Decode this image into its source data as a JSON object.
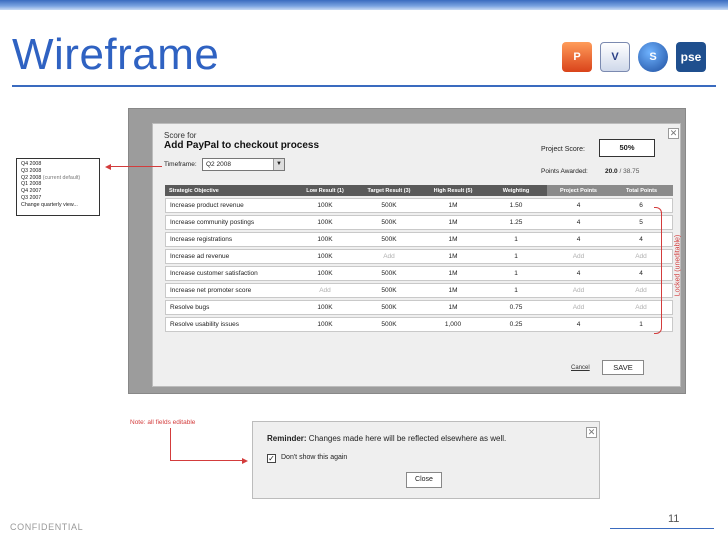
{
  "slide": {
    "title": "Wireframe",
    "footer_left": "CONFIDENTIAL",
    "page_number": "11",
    "app_icons": [
      "powerpoint-icon",
      "visio-icon",
      "sharepoint-icon",
      "pse-icon"
    ],
    "pse_icon_text": "pse"
  },
  "dialog": {
    "score_for_label": "Score for",
    "goal_title": "Add PayPal to checkout process",
    "timeframe_label": "Timeframe:",
    "timeframe_value": "Q2 2008",
    "project_score_label": "Project Score:",
    "project_score_value": "50%",
    "points_awarded_label": "Points Awarded:",
    "points_awarded_value": "20.0",
    "points_awarded_total": " / 38.75",
    "close_symbol": "✕",
    "cancel_label": "Cancel",
    "save_label": "SAVE"
  },
  "table": {
    "headers": [
      "Strategic Objective",
      "Low Result (1)",
      "Target Result (3)",
      "High Result (5)",
      "Weighting",
      "Project Points",
      "Total Points"
    ],
    "rows": [
      [
        "Increase product revenue",
        "100K",
        "500K",
        "1M",
        "1.50",
        "4",
        "6"
      ],
      [
        "Increase community postings",
        "100K",
        "500K",
        "1M",
        "1.25",
        "4",
        "5"
      ],
      [
        "Increase registrations",
        "100K",
        "500K",
        "1M",
        "1",
        "4",
        "4"
      ],
      [
        "Increase ad revenue",
        "100K",
        "Add",
        "1M",
        "1",
        "Add",
        "Add"
      ],
      [
        "Increase customer satisfaction",
        "100K",
        "500K",
        "1M",
        "1",
        "4",
        "4"
      ],
      [
        "Increase net promoter score",
        "Add",
        "500K",
        "1M",
        "1",
        "Add",
        "Add"
      ],
      [
        "Resolve bugs",
        "100K",
        "500K",
        "1M",
        "0.75",
        "Add",
        "Add"
      ],
      [
        "Resolve usability issues",
        "100K",
        "500K",
        "1,000",
        "0.25",
        "4",
        "1"
      ]
    ]
  },
  "annotations": {
    "quarter_options": [
      "Q4 2008",
      "Q3 2008",
      "Q2 2008",
      "Q1 2008",
      "Q4 2007",
      "Q3 2007",
      "Change quarterly view..."
    ],
    "current_default_suffix": " (current default)",
    "locked_label": "Locked (uneditable)",
    "note": "Note: all fields editable"
  },
  "reminder": {
    "title_bold": "Reminder:",
    "title_text": " Changes made here will be reflected elsewhere as well.",
    "checkbox_label": "Don't show this again",
    "checkbox_mark": "✓",
    "close_label": "Close",
    "close_symbol": "✕"
  },
  "colors": {
    "title_blue": "#2f62c2",
    "annotation_red": "#d33c3c",
    "header_gray": "#5a5a5a"
  }
}
